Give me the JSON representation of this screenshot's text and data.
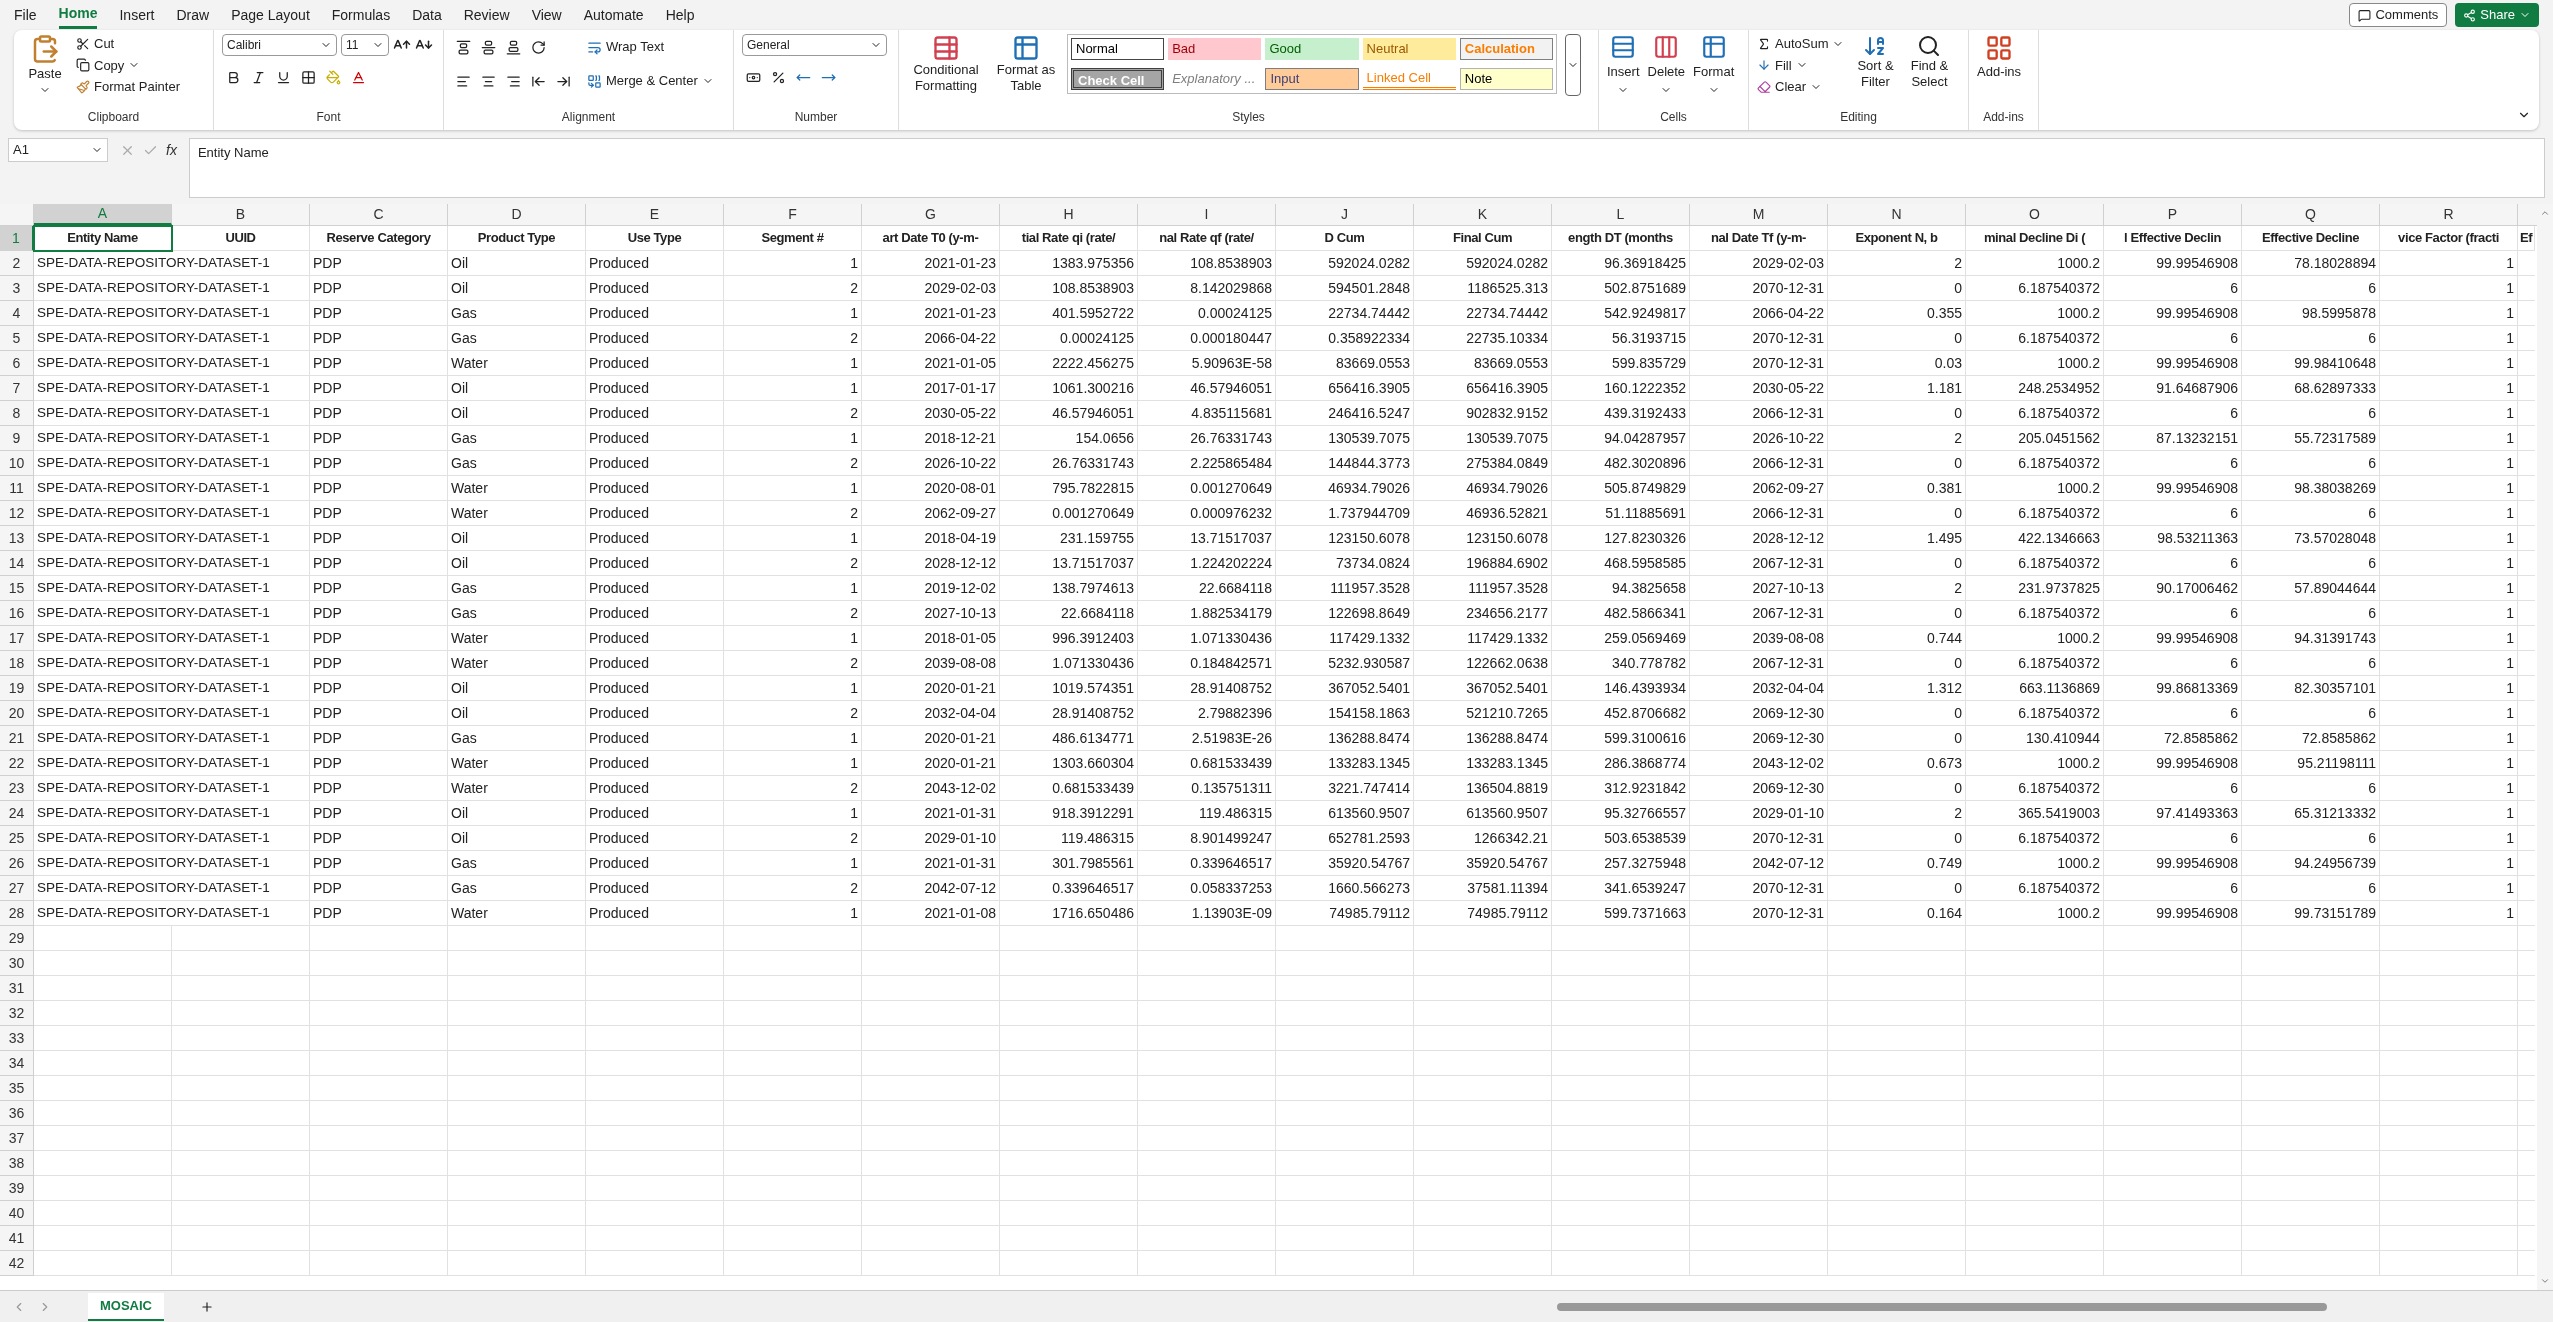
{
  "menu": [
    {
      "label": "File",
      "selected": false
    },
    {
      "label": "Home",
      "selected": true
    },
    {
      "label": "Insert",
      "selected": false
    },
    {
      "label": "Draw",
      "selected": false
    },
    {
      "label": "Page Layout",
      "selected": false
    },
    {
      "label": "Formulas",
      "selected": false
    },
    {
      "label": "Data",
      "selected": false
    },
    {
      "label": "Review",
      "selected": false
    },
    {
      "label": "View",
      "selected": false
    },
    {
      "label": "Automate",
      "selected": false
    },
    {
      "label": "Help",
      "selected": false
    }
  ],
  "top_buttons": {
    "comments": "Comments",
    "share": "Share"
  },
  "ribbon": {
    "clipboard": {
      "label": "Clipboard",
      "paste": "Paste",
      "cut": "Cut",
      "copy": "Copy",
      "format_painter": "Format Painter"
    },
    "font": {
      "label": "Font",
      "name": "Calibri",
      "size": "11"
    },
    "alignment": {
      "label": "Alignment",
      "wrap": "Wrap Text",
      "merge": "Merge & Center"
    },
    "number": {
      "label": "Number",
      "format": "General"
    },
    "styles": {
      "label": "Styles",
      "conditional": "Conditional Formatting",
      "format_table": "Format as Table",
      "cells": [
        {
          "label": "Normal",
          "kind": "normal"
        },
        {
          "label": "Bad",
          "kind": "bad"
        },
        {
          "label": "Good",
          "kind": "good"
        },
        {
          "label": "Neutral",
          "kind": "neutral"
        },
        {
          "label": "Calculation",
          "kind": "calculation"
        },
        {
          "label": "Check Cell",
          "kind": "check"
        },
        {
          "label": "Explanatory ...",
          "kind": "explanatory"
        },
        {
          "label": "Input",
          "kind": "input"
        },
        {
          "label": "Linked Cell",
          "kind": "linked"
        },
        {
          "label": "Note",
          "kind": "note"
        }
      ]
    },
    "cells": {
      "label": "Cells",
      "buttons": [
        "Insert",
        "Delete",
        "Format"
      ]
    },
    "editing": {
      "label": "Editing",
      "autosum": "AutoSum",
      "fill": "Fill",
      "clear": "Clear",
      "sort": "Sort & Filter",
      "find": "Find & Select"
    },
    "addins": {
      "label": "Add-ins",
      "button": "Add-ins"
    }
  },
  "formula_bar": {
    "name_box": "A1",
    "fx": "fx",
    "value": "Entity Name"
  },
  "sheet": {
    "columns": [
      {
        "label": "A",
        "selected": true
      },
      {
        "label": "B",
        "selected": false
      },
      {
        "label": "C",
        "selected": false
      },
      {
        "label": "D",
        "selected": false
      },
      {
        "label": "E",
        "selected": false
      },
      {
        "label": "F",
        "selected": false
      },
      {
        "label": "G",
        "selected": false
      },
      {
        "label": "H",
        "selected": false
      },
      {
        "label": "I",
        "selected": false
      },
      {
        "label": "J",
        "selected": false
      },
      {
        "label": "K",
        "selected": false
      },
      {
        "label": "L",
        "selected": false
      },
      {
        "label": "M",
        "selected": false
      },
      {
        "label": "N",
        "selected": false
      },
      {
        "label": "O",
        "selected": false
      },
      {
        "label": "P",
        "selected": false
      },
      {
        "label": "Q",
        "selected": false
      },
      {
        "label": "R",
        "selected": false
      }
    ],
    "headers": [
      "Entity Name",
      "UUID",
      "Reserve Category",
      "Product Type",
      "Use Type",
      "Segment #",
      "art Date T0  (y-m-",
      "tial Rate qi (rate/",
      "nal Rate qf (rate/",
      "D Cum",
      "Final Cum",
      "ength DT (months",
      "nal Date Tf  (y-m-",
      "Exponent N, b",
      "minal Decline Di (",
      "l Effective Declin",
      "Effective Decline",
      "vice Factor (fracti",
      "Ef"
    ],
    "rows": [
      {
        "entity": "SPE-DATA-REPOSITORY-DATASET-1",
        "values": [
          "PDP",
          "Oil",
          "Produced",
          "1",
          "2021-01-23",
          "1383.975356",
          "108.8538903",
          "592024.0282",
          "592024.0282",
          "96.36918425",
          "2029-02-03",
          "2",
          "1000.2",
          "99.99546908",
          "78.18028894",
          "1"
        ]
      },
      {
        "entity": "SPE-DATA-REPOSITORY-DATASET-1",
        "values": [
          "PDP",
          "Oil",
          "Produced",
          "2",
          "2029-02-03",
          "108.8538903",
          "8.142029868",
          "594501.2848",
          "1186525.313",
          "502.8751689",
          "2070-12-31",
          "0",
          "6.187540372",
          "6",
          "6",
          "1"
        ]
      },
      {
        "entity": "SPE-DATA-REPOSITORY-DATASET-1",
        "values": [
          "PDP",
          "Gas",
          "Produced",
          "1",
          "2021-01-23",
          "401.5952722",
          "0.00024125",
          "22734.74442",
          "22734.74442",
          "542.9249817",
          "2066-04-22",
          "0.355",
          "1000.2",
          "99.99546908",
          "98.5995878",
          "1"
        ]
      },
      {
        "entity": "SPE-DATA-REPOSITORY-DATASET-1",
        "values": [
          "PDP",
          "Gas",
          "Produced",
          "2",
          "2066-04-22",
          "0.00024125",
          "0.000180447",
          "0.358922334",
          "22735.10334",
          "56.3193715",
          "2070-12-31",
          "0",
          "6.187540372",
          "6",
          "6",
          "1"
        ]
      },
      {
        "entity": "SPE-DATA-REPOSITORY-DATASET-1",
        "values": [
          "PDP",
          "Water",
          "Produced",
          "1",
          "2021-01-05",
          "2222.456275",
          "5.90963E-58",
          "83669.0553",
          "83669.0553",
          "599.835729",
          "2070-12-31",
          "0.03",
          "1000.2",
          "99.99546908",
          "99.98410648",
          "1"
        ]
      },
      {
        "entity": "SPE-DATA-REPOSITORY-DATASET-1",
        "values": [
          "PDP",
          "Oil",
          "Produced",
          "1",
          "2017-01-17",
          "1061.300216",
          "46.57946051",
          "656416.3905",
          "656416.3905",
          "160.1222352",
          "2030-05-22",
          "1.181",
          "248.2534952",
          "91.64687906",
          "68.62897333",
          "1"
        ]
      },
      {
        "entity": "SPE-DATA-REPOSITORY-DATASET-1",
        "values": [
          "PDP",
          "Oil",
          "Produced",
          "2",
          "2030-05-22",
          "46.57946051",
          "4.835115681",
          "246416.5247",
          "902832.9152",
          "439.3192433",
          "2066-12-31",
          "0",
          "6.187540372",
          "6",
          "6",
          "1"
        ]
      },
      {
        "entity": "SPE-DATA-REPOSITORY-DATASET-1",
        "values": [
          "PDP",
          "Gas",
          "Produced",
          "1",
          "2018-12-21",
          "154.0656",
          "26.76331743",
          "130539.7075",
          "130539.7075",
          "94.04287957",
          "2026-10-22",
          "2",
          "205.0451562",
          "87.13232151",
          "55.72317589",
          "1"
        ]
      },
      {
        "entity": "SPE-DATA-REPOSITORY-DATASET-1",
        "values": [
          "PDP",
          "Gas",
          "Produced",
          "2",
          "2026-10-22",
          "26.76331743",
          "2.225865484",
          "144844.3773",
          "275384.0849",
          "482.3020896",
          "2066-12-31",
          "0",
          "6.187540372",
          "6",
          "6",
          "1"
        ]
      },
      {
        "entity": "SPE-DATA-REPOSITORY-DATASET-1",
        "values": [
          "PDP",
          "Water",
          "Produced",
          "1",
          "2020-08-01",
          "795.7822815",
          "0.001270649",
          "46934.79026",
          "46934.79026",
          "505.8749829",
          "2062-09-27",
          "0.381",
          "1000.2",
          "99.99546908",
          "98.38038269",
          "1"
        ]
      },
      {
        "entity": "SPE-DATA-REPOSITORY-DATASET-1",
        "values": [
          "PDP",
          "Water",
          "Produced",
          "2",
          "2062-09-27",
          "0.001270649",
          "0.000976232",
          "1.737944709",
          "46936.52821",
          "51.11885691",
          "2066-12-31",
          "0",
          "6.187540372",
          "6",
          "6",
          "1"
        ]
      },
      {
        "entity": "SPE-DATA-REPOSITORY-DATASET-1",
        "values": [
          "PDP",
          "Oil",
          "Produced",
          "1",
          "2018-04-19",
          "231.159755",
          "13.71517037",
          "123150.6078",
          "123150.6078",
          "127.8230326",
          "2028-12-12",
          "1.495",
          "422.1346663",
          "98.53211363",
          "73.57028048",
          "1"
        ]
      },
      {
        "entity": "SPE-DATA-REPOSITORY-DATASET-1",
        "values": [
          "PDP",
          "Oil",
          "Produced",
          "2",
          "2028-12-12",
          "13.71517037",
          "1.224202224",
          "73734.0824",
          "196884.6902",
          "468.5958585",
          "2067-12-31",
          "0",
          "6.187540372",
          "6",
          "6",
          "1"
        ]
      },
      {
        "entity": "SPE-DATA-REPOSITORY-DATASET-1",
        "values": [
          "PDP",
          "Gas",
          "Produced",
          "1",
          "2019-12-02",
          "138.7974613",
          "22.6684118",
          "111957.3528",
          "111957.3528",
          "94.3825658",
          "2027-10-13",
          "2",
          "231.9737825",
          "90.17006462",
          "57.89044644",
          "1"
        ]
      },
      {
        "entity": "SPE-DATA-REPOSITORY-DATASET-1",
        "values": [
          "PDP",
          "Gas",
          "Produced",
          "2",
          "2027-10-13",
          "22.6684118",
          "1.882534179",
          "122698.8649",
          "234656.2177",
          "482.5866341",
          "2067-12-31",
          "0",
          "6.187540372",
          "6",
          "6",
          "1"
        ]
      },
      {
        "entity": "SPE-DATA-REPOSITORY-DATASET-1",
        "values": [
          "PDP",
          "Water",
          "Produced",
          "1",
          "2018-01-05",
          "996.3912403",
          "1.071330436",
          "117429.1332",
          "117429.1332",
          "259.0569469",
          "2039-08-08",
          "0.744",
          "1000.2",
          "99.99546908",
          "94.31391743",
          "1"
        ]
      },
      {
        "entity": "SPE-DATA-REPOSITORY-DATASET-1",
        "values": [
          "PDP",
          "Water",
          "Produced",
          "2",
          "2039-08-08",
          "1.071330436",
          "0.184842571",
          "5232.930587",
          "122662.0638",
          "340.778782",
          "2067-12-31",
          "0",
          "6.187540372",
          "6",
          "6",
          "1"
        ]
      },
      {
        "entity": "SPE-DATA-REPOSITORY-DATASET-1",
        "values": [
          "PDP",
          "Oil",
          "Produced",
          "1",
          "2020-01-21",
          "1019.574351",
          "28.91408752",
          "367052.5401",
          "367052.5401",
          "146.4393934",
          "2032-04-04",
          "1.312",
          "663.1136869",
          "99.86813369",
          "82.30357101",
          "1"
        ]
      },
      {
        "entity": "SPE-DATA-REPOSITORY-DATASET-1",
        "values": [
          "PDP",
          "Oil",
          "Produced",
          "2",
          "2032-04-04",
          "28.91408752",
          "2.79882396",
          "154158.1863",
          "521210.7265",
          "452.8706682",
          "2069-12-30",
          "0",
          "6.187540372",
          "6",
          "6",
          "1"
        ]
      },
      {
        "entity": "SPE-DATA-REPOSITORY-DATASET-1",
        "values": [
          "PDP",
          "Gas",
          "Produced",
          "1",
          "2020-01-21",
          "486.6134771",
          "2.51983E-26",
          "136288.8474",
          "136288.8474",
          "599.3100616",
          "2069-12-30",
          "0",
          "130.410944",
          "72.8585862",
          "72.8585862",
          "1"
        ]
      },
      {
        "entity": "SPE-DATA-REPOSITORY-DATASET-1",
        "values": [
          "PDP",
          "Water",
          "Produced",
          "1",
          "2020-01-21",
          "1303.660304",
          "0.681533439",
          "133283.1345",
          "133283.1345",
          "286.3868774",
          "2043-12-02",
          "0.673",
          "1000.2",
          "99.99546908",
          "95.21198111",
          "1"
        ]
      },
      {
        "entity": "SPE-DATA-REPOSITORY-DATASET-1",
        "values": [
          "PDP",
          "Water",
          "Produced",
          "2",
          "2043-12-02",
          "0.681533439",
          "0.135751311",
          "3221.747414",
          "136504.8819",
          "312.9231842",
          "2069-12-30",
          "0",
          "6.187540372",
          "6",
          "6",
          "1"
        ]
      },
      {
        "entity": "SPE-DATA-REPOSITORY-DATASET-1",
        "values": [
          "PDP",
          "Oil",
          "Produced",
          "1",
          "2021-01-31",
          "918.3912291",
          "119.486315",
          "613560.9507",
          "613560.9507",
          "95.32766557",
          "2029-01-10",
          "2",
          "365.5419003",
          "97.41493363",
          "65.31213332",
          "1"
        ]
      },
      {
        "entity": "SPE-DATA-REPOSITORY-DATASET-1",
        "values": [
          "PDP",
          "Oil",
          "Produced",
          "2",
          "2029-01-10",
          "119.486315",
          "8.901499247",
          "652781.2593",
          "1266342.21",
          "503.6538539",
          "2070-12-31",
          "0",
          "6.187540372",
          "6",
          "6",
          "1"
        ]
      },
      {
        "entity": "SPE-DATA-REPOSITORY-DATASET-1",
        "values": [
          "PDP",
          "Gas",
          "Produced",
          "1",
          "2021-01-31",
          "301.7985561",
          "0.339646517",
          "35920.54767",
          "35920.54767",
          "257.3275948",
          "2042-07-12",
          "0.749",
          "1000.2",
          "99.99546908",
          "94.24956739",
          "1"
        ]
      },
      {
        "entity": "SPE-DATA-REPOSITORY-DATASET-1",
        "values": [
          "PDP",
          "Gas",
          "Produced",
          "2",
          "2042-07-12",
          "0.339646517",
          "0.058337253",
          "1660.566273",
          "37581.11394",
          "341.6539247",
          "2070-12-31",
          "0",
          "6.187540372",
          "6",
          "6",
          "1"
        ]
      },
      {
        "entity": "SPE-DATA-REPOSITORY-DATASET-1",
        "values": [
          "PDP",
          "Water",
          "Produced",
          "1",
          "2021-01-08",
          "1716.650486",
          "1.13903E-09",
          "74985.79112",
          "74985.79112",
          "599.7371663",
          "2070-12-31",
          "0.164",
          "1000.2",
          "99.99546908",
          "99.73151789",
          "1"
        ]
      }
    ],
    "row_numbers": [
      {
        "label": "1",
        "selected": true
      },
      {
        "label": "2",
        "selected": false
      },
      {
        "label": "3",
        "selected": false
      },
      {
        "label": "4",
        "selected": false
      },
      {
        "label": "5",
        "selected": false
      },
      {
        "label": "6",
        "selected": false
      },
      {
        "label": "7",
        "selected": false
      },
      {
        "label": "8",
        "selected": false
      },
      {
        "label": "9",
        "selected": false
      },
      {
        "label": "10",
        "selected": false
      },
      {
        "label": "11",
        "selected": false
      },
      {
        "label": "12",
        "selected": false
      },
      {
        "label": "13",
        "selected": false
      },
      {
        "label": "14",
        "selected": false
      },
      {
        "label": "15",
        "selected": false
      },
      {
        "label": "16",
        "selected": false
      },
      {
        "label": "17",
        "selected": false
      },
      {
        "label": "18",
        "selected": false
      },
      {
        "label": "19",
        "selected": false
      },
      {
        "label": "20",
        "selected": false
      },
      {
        "label": "21",
        "selected": false
      },
      {
        "label": "22",
        "selected": false
      },
      {
        "label": "23",
        "selected": false
      },
      {
        "label": "24",
        "selected": false
      },
      {
        "label": "25",
        "selected": false
      },
      {
        "label": "26",
        "selected": false
      },
      {
        "label": "27",
        "selected": false
      },
      {
        "label": "28",
        "selected": false
      },
      {
        "label": "29",
        "selected": false
      },
      {
        "label": "30",
        "selected": false
      },
      {
        "label": "31",
        "selected": false
      },
      {
        "label": "32",
        "selected": false
      },
      {
        "label": "33",
        "selected": false
      },
      {
        "label": "34",
        "selected": false
      },
      {
        "label": "35",
        "selected": false
      },
      {
        "label": "36",
        "selected": false
      },
      {
        "label": "37",
        "selected": false
      },
      {
        "label": "38",
        "selected": false
      },
      {
        "label": "39",
        "selected": false
      },
      {
        "label": "40",
        "selected": false
      },
      {
        "label": "41",
        "selected": false
      },
      {
        "label": "42",
        "selected": false
      }
    ]
  },
  "sheet_tabs": [
    {
      "label": "MOSAIC",
      "selected": true
    }
  ]
}
